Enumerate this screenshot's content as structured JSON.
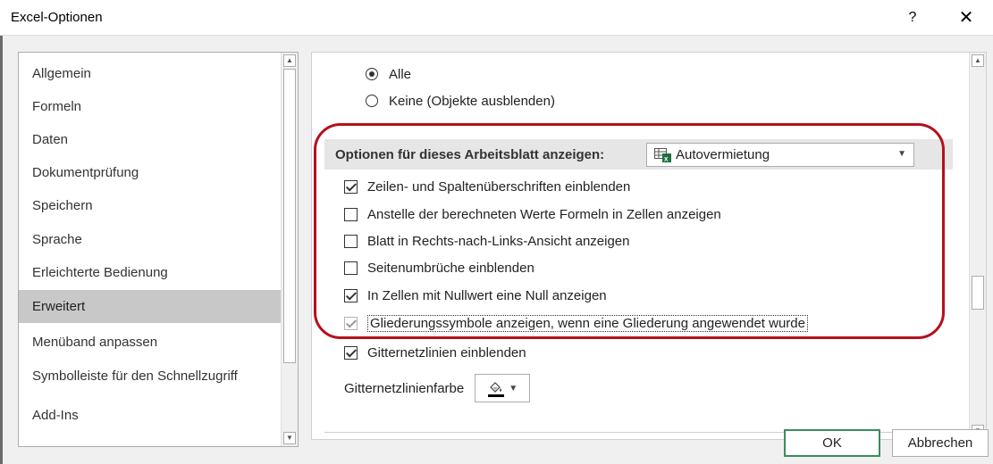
{
  "window": {
    "title": "Excel-Optionen",
    "help_label": "?",
    "close_label": "✕"
  },
  "nav": {
    "items": [
      {
        "label": "Allgemein"
      },
      {
        "label": "Formeln"
      },
      {
        "label": "Daten"
      },
      {
        "label": "Dokumentprüfung"
      },
      {
        "label": "Speichern"
      },
      {
        "label": "Sprache"
      },
      {
        "label": "Erleichterte Bedienung"
      },
      {
        "label": "Erweitert",
        "selected": true
      },
      {
        "label": "Menüband anpassen"
      },
      {
        "label": "Symbolleiste für den Schnellzugriff"
      },
      {
        "label": "Add-Ins"
      }
    ]
  },
  "objects_radio": {
    "options": [
      {
        "label": "Alle",
        "checked": true
      },
      {
        "label": "Keine (Objekte ausblenden)",
        "checked": false
      }
    ]
  },
  "worksheet_section": {
    "header_label": "Optionen für dieses Arbeitsblatt anzeigen:",
    "sheet_selected": "Autovermietung",
    "options": [
      {
        "label": "Zeilen- und Spaltenüberschriften einblenden",
        "checked": true
      },
      {
        "label": "Anstelle der berechneten Werte Formeln in Zellen anzeigen",
        "checked": false
      },
      {
        "label": "Blatt in Rechts-nach-Links-Ansicht anzeigen",
        "checked": false
      },
      {
        "label": "Seitenumbrüche einblenden",
        "checked": false
      },
      {
        "label": "In Zellen mit Nullwert eine Null anzeigen",
        "checked": true
      },
      {
        "label": "Gliederungssymbole anzeigen, wenn eine Gliederung angewendet wurde",
        "checked": true,
        "disabled": true,
        "focused": true
      },
      {
        "label": "Gitternetzlinien einblenden",
        "checked": true
      }
    ],
    "gridline_color_label": "Gitternetzlinienfarbe",
    "gridline_color": "#000000"
  },
  "highlight_color": "#b4101c",
  "buttons": {
    "ok": "OK",
    "cancel": "Abbrechen"
  }
}
